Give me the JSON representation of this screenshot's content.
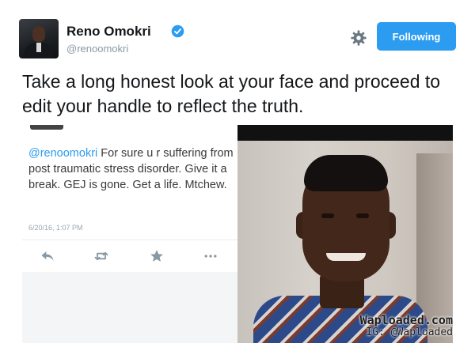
{
  "user": {
    "display_name": "Reno Omokri",
    "handle": "@renoomokri",
    "verified": true,
    "avatar_icon": "user-avatar"
  },
  "actions": {
    "follow_label": "Following",
    "settings_icon": "gear-icon"
  },
  "tweet": {
    "text": "Take a long honest look at your face and proceed to edit your handle to reflect the truth."
  },
  "embedded_tweet": {
    "mention": "@renoomokri",
    "text": " For sure u r suffering from post traumatic stress disorder. Give it a break. GEJ is gone. Get a life. Mtchew.",
    "timestamp": "6/20/16, 1:07 PM",
    "actions": [
      "reply-icon",
      "retweet-icon",
      "like-icon",
      "more-icon"
    ]
  },
  "watermark": {
    "line1": "Waploaded.com",
    "line2": "IG: @Waploaded"
  },
  "colors": {
    "accent": "#2b9cf0",
    "text": "#14171a",
    "secondary": "#8899a6"
  }
}
